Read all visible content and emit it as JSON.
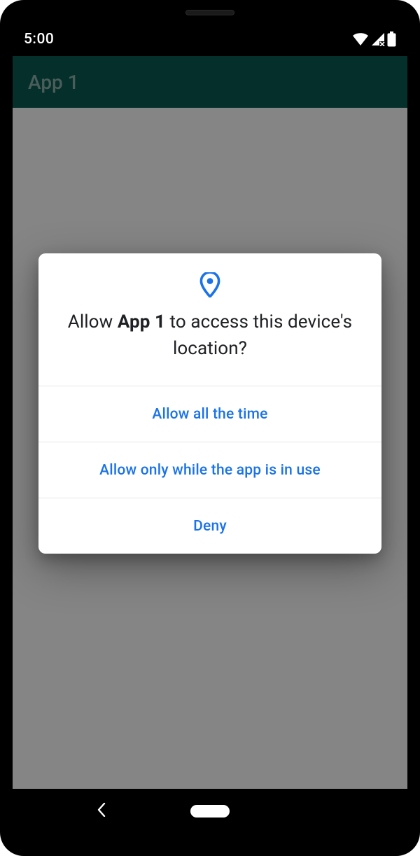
{
  "status": {
    "time": "5:00"
  },
  "app": {
    "title": "App 1"
  },
  "dialog": {
    "prompt_prefix": "Allow ",
    "prompt_app_name": "App 1",
    "prompt_suffix": " to access this device's location?",
    "options": {
      "allow_always": "Allow all the time",
      "allow_foreground": "Allow only while the app is in use",
      "deny": "Deny"
    }
  }
}
